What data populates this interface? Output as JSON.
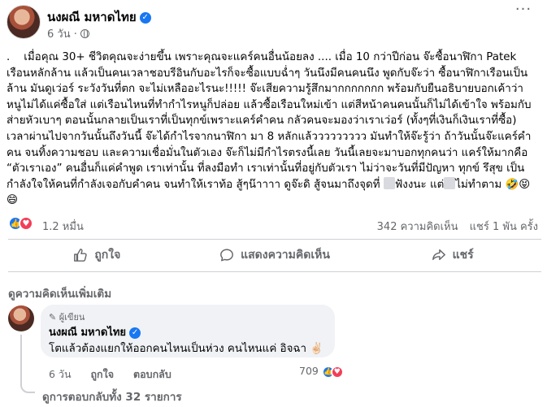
{
  "post": {
    "author": "นงผณี มหาดไทย",
    "time": "6 วัน",
    "separator": "·",
    "more": "···",
    "text_p1": ".    เมื่อคุณ 30+ ชีวิตคุณจะง่ายขึ้น เพราะคุณจะแคร์คนอื่นน้อยลง .... เมื่อ 10 กว่าปีก่อน จ๊ะซื้อนาฬิกา Patek เรือนหลักล้าน แล้วเป็นคนเวลาชอบรีอินกับอะไรก็จะซื้อแบบฉ่ำๆ วันนึงมีคนคนนึง พูดกับจ๊ะว่า ซื้อนาฬิกาเรือนเป็นล้าน มันดูเว่อร์ ระวังวันที่ตก จะไม่เหลืออะไรนะ!!!!! จ๊ะเสียความรู้สึกมากกกกกกก พร้อมกับยืนอธิบายบอกเค้าว่า หนูไม่ได้แค่ซื้อใส่ แต่เรือนไหนที่ทำกำไรหนูก็ปล่อย แล้วซื้อเรือนใหม่เข้า แต่สีหน้าคนคนนั้นก็ไม่ได้เข้าใจ พร้อมกับส่ายหัวเบาๆ ตอนนั้นกลายเป็นเราที่เป็นทุกข์เพราะแคร์คำคน กลัวคนจะมองว่าเราเว่อร์ (ทั้งๆที่เงินก็เงินเราที่ซื้อ) เวลาผ่านไปจากวันนั้นถึงวันนี้ จ๊ะได้กำไรจากนาฬิกา มา 8 หลักแล้ววววววววว มันทำให้จ๊ะรู้ว่า ถ้าวันนั้นจ๊ะแคร์คำคน จนทิ้งความชอบ และความเชื่อมั่นในตัวเอง จ๊ะก็ไม่มีกำไรตรงนี้เลย วันนี้เลยจะมาบอกทุกคนว่า แคร์ให้มากคือ “ตัวเราเอง” คนอื่นก็แค่คำพูด เราเท่านั้น ที่ลงมือทำ เราเท่านั้นที่อยู่กับตัวเรา ไม่ว่าจะวันที่มีปัญหา ทุกข์ รึสุข เป็นกำลังใจให้คนที่กำลังเจอกับคำคน จนทำให้เราท้อ สู้ๆน๊าาาา ดูจ๊ะดิ สู้จนมาถึงจุดที่ ",
    "text_p2": "ฟังงนะ แต่",
    "text_p3": "ไม่ทำตาม 🤣😝😄",
    "reaction_count": "1.2 หมื่น",
    "comments_count": "342 ความคิดเห็น",
    "shares_count": "แชร์ 1 พัน ครั้ง",
    "actions": {
      "like": "ถูกใจ",
      "comment": "แสดงความคิดเห็น",
      "share": "แชร์"
    }
  },
  "comments_section": {
    "more_comments": "ดูความคิดเห็นเพิ่มเติม",
    "comment": {
      "role": "ผู้เขียน",
      "author": "นงผณี มหาดไทย",
      "text": "โตแล้วต้องแยกให้ออกคนไหนเป็นห่วง คนไหนแค่ อิจฉา ✌🏻",
      "time": "6 วัน",
      "like": "ถูกใจ",
      "reply": "ตอบกลับ",
      "reaction_count": "709"
    },
    "view_replies": "ดูการตอบกลับทั้ง 32 รายการ"
  },
  "colors": {
    "accent": "#1877f2",
    "love": "#f33e58",
    "muted": "#65676b",
    "bubble": "#f0f2f5"
  }
}
